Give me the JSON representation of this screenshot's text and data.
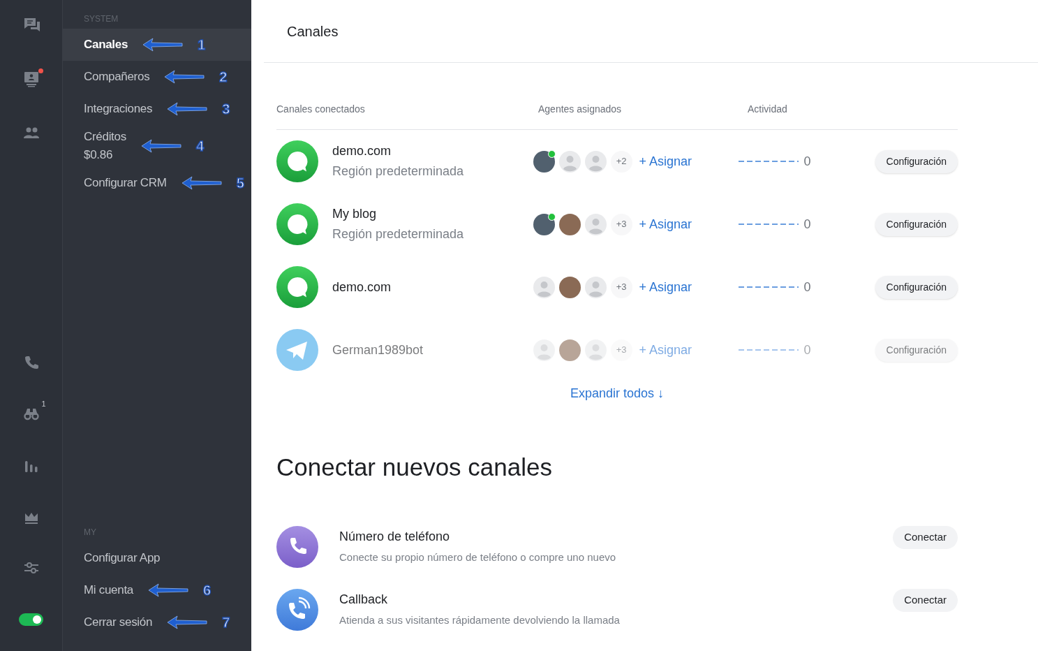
{
  "rail": {
    "items": [
      {
        "kind": "chat",
        "dot": false
      },
      {
        "kind": "monitor",
        "dot": true
      },
      {
        "kind": "people",
        "dot": false
      },
      {
        "kind": "phone",
        "dot": false
      },
      {
        "kind": "binoculars",
        "dot": false,
        "badge": "1"
      },
      {
        "kind": "bars",
        "dot": false
      },
      {
        "kind": "crown",
        "dot": false
      },
      {
        "kind": "sliders",
        "dot": false
      }
    ],
    "toggle": {
      "on": true
    }
  },
  "sidebar": {
    "sections": [
      {
        "title": "SYSTEM",
        "items": [
          {
            "label": "Canales",
            "selected": true,
            "annotation": "1"
          },
          {
            "label": "Compañeros",
            "selected": false,
            "annotation": "2"
          },
          {
            "label": "Integraciones",
            "selected": false,
            "annotation": "3"
          },
          {
            "label": "Créditos",
            "sub": "$0.86",
            "selected": false,
            "annotation": "4"
          },
          {
            "label": "Configurar CRM",
            "selected": false,
            "annotation": "5"
          }
        ]
      },
      {
        "title": "MY",
        "items": [
          {
            "label": "Configurar App",
            "selected": false
          },
          {
            "label": "Mi cuenta",
            "selected": false,
            "annotation": "6"
          },
          {
            "label": "Cerrar sesión",
            "selected": false,
            "annotation": "7"
          }
        ]
      }
    ]
  },
  "header": {
    "title": "Canales"
  },
  "table": {
    "columns": [
      "Canales conectados",
      "Agentes asignados",
      "Actividad"
    ],
    "rows": [
      {
        "kind": "chat",
        "name": "demo.com",
        "region": "Región predeterminada",
        "avatars": [
          {
            "kind": "screenshot",
            "online": true
          },
          {
            "kind": "placeholder",
            "online": false
          },
          {
            "kind": "placeholder",
            "online": false
          }
        ],
        "more": "+2",
        "assign": "+ Asignar",
        "activity": "0",
        "button": "Configuración",
        "faded": false
      },
      {
        "kind": "chat",
        "name": "My blog",
        "region": "Región predeterminada",
        "avatars": [
          {
            "kind": "screenshot",
            "online": true
          },
          {
            "kind": "photo",
            "online": false
          },
          {
            "kind": "placeholder",
            "online": false
          }
        ],
        "more": "+3",
        "assign": "+ Asignar",
        "activity": "0",
        "button": "Configuración",
        "faded": false
      },
      {
        "kind": "chat",
        "name": "demo.com",
        "avatars": [
          {
            "kind": "placeholder",
            "online": false
          },
          {
            "kind": "photo",
            "online": false
          },
          {
            "kind": "placeholder",
            "online": false
          }
        ],
        "more": "+3",
        "assign": "+ Asignar",
        "activity": "0",
        "button": "Configuración",
        "faded": false
      },
      {
        "kind": "telegram",
        "name": "German1989bot",
        "avatars": [
          {
            "kind": "placeholder",
            "online": false
          },
          {
            "kind": "photo",
            "online": false
          },
          {
            "kind": "placeholder",
            "online": false
          }
        ],
        "more": "+3",
        "assign": "+ Asignar",
        "activity": "0",
        "button": "Configuración",
        "faded": true
      }
    ],
    "expand": "Expandir todos ↓"
  },
  "connect": {
    "title": "Conectar nuevos canales",
    "items": [
      {
        "kind": "phone",
        "title": "Número de teléfono",
        "description": "Conecte su propio número de teléfono o compre uno nuevo",
        "button": "Conectar"
      },
      {
        "kind": "callback",
        "title": "Callback",
        "description": "Atienda a sus visitantes rápidamente devolviendo la llamada",
        "button": "Conectar"
      }
    ]
  }
}
